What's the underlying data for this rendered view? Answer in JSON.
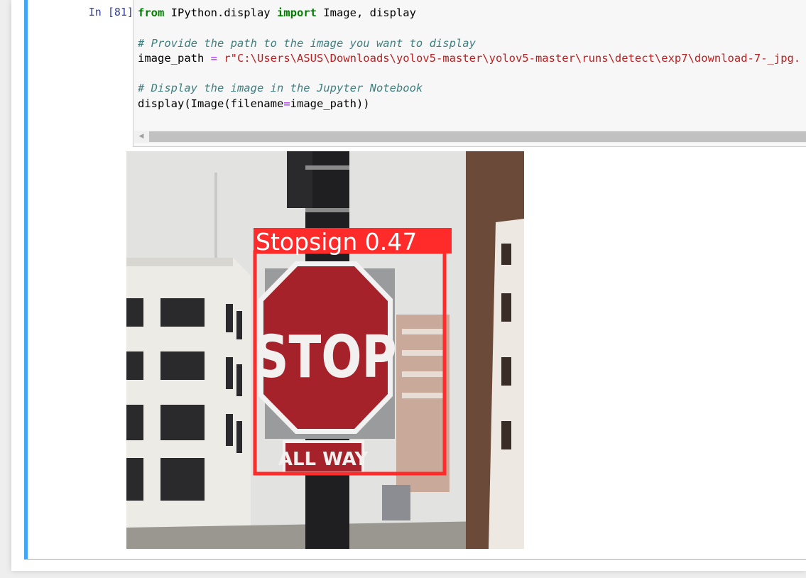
{
  "cell": {
    "prompt": "In [81]:",
    "code_lines": {
      "l1_kw1": "from",
      "l1_mid": " IPython.display ",
      "l1_kw2": "import",
      "l1_end": " Image, display",
      "l3_comment": "# Provide the path to the image you want to display",
      "l4_var": "image_path ",
      "l4_eq": "=",
      "l4_sp": " ",
      "l4_str": "r\"C:\\Users\\ASUS\\Downloads\\yolov5-master\\yolov5-master\\runs\\detect\\exp7\\download-7-_jpg.",
      "l6_comment": "# Display the image in the Jupyter Notebook",
      "l7_a": "display(Image(filename",
      "l7_eq": "=",
      "l7_b": "image_path))"
    }
  },
  "output": {
    "detection_label": "Stopsign 0.47",
    "sign_text": "STOP",
    "plate_text": "ALL WAY"
  },
  "colors": {
    "cell_accent": "#42a5f5",
    "prompt": "#303f9f",
    "bbox": "#ff2b2b"
  }
}
